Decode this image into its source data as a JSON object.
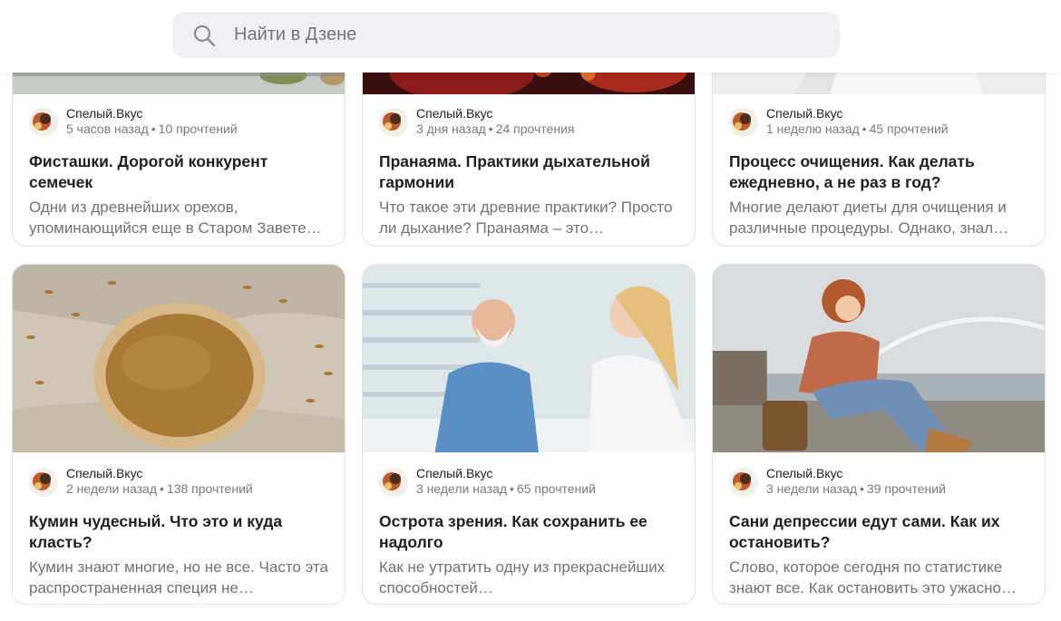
{
  "search": {
    "placeholder": "Найти в Дзене"
  },
  "cards": [
    {
      "author": "Спелый.Вкус",
      "time": "5 часов назад",
      "reads": "10 прочтений",
      "title": "Фисташки. Дорогой конкурент семечек",
      "snippet": "Одни из древнейших орехов, упоминающийся еще в Старом Завете…"
    },
    {
      "author": "Спелый.Вкус",
      "time": "3 дня назад",
      "reads": "24 прочтения",
      "title": "Пранаяма. Практики дыхательной гармонии",
      "snippet": "Что такое эти древние практики? Просто ли дыхание? Пранаяма – это…"
    },
    {
      "author": "Спелый.Вкус",
      "time": "1 неделю назад",
      "reads": "45 прочтений",
      "title": "Процесс очищения. Как делать ежедневно, а не раз в год?",
      "snippet": "Многие делают диеты для очищения и различные процедуры. Однако, знал…"
    },
    {
      "author": "Спелый.Вкус",
      "time": "2 недели назад",
      "reads": "138 прочтений",
      "title": "Кумин чудесный. Что это и куда класть?",
      "snippet": "Кумин знают многие, но не все. Часто эта распространенная специя не…"
    },
    {
      "author": "Спелый.Вкус",
      "time": "3 недели назад",
      "reads": "65 прочтений",
      "title": "Острота зрения. Как сохранить ее надолго",
      "snippet": "Как не утратить одну из прекраснейших способностей…"
    },
    {
      "author": "Спелый.Вкус",
      "time": "3 недели назад",
      "reads": "39 прочтений",
      "title": "Сани депрессии едут сами. Как их остановить?",
      "snippet": "Слово, которое сегодня по статистике знают все. Как остановить это ужасно…"
    }
  ],
  "separator": "•",
  "colors": {
    "search_bg": "#eef0f3",
    "text": "#1f1f1f",
    "muted": "#777a80",
    "border": "#e0e2e6"
  }
}
